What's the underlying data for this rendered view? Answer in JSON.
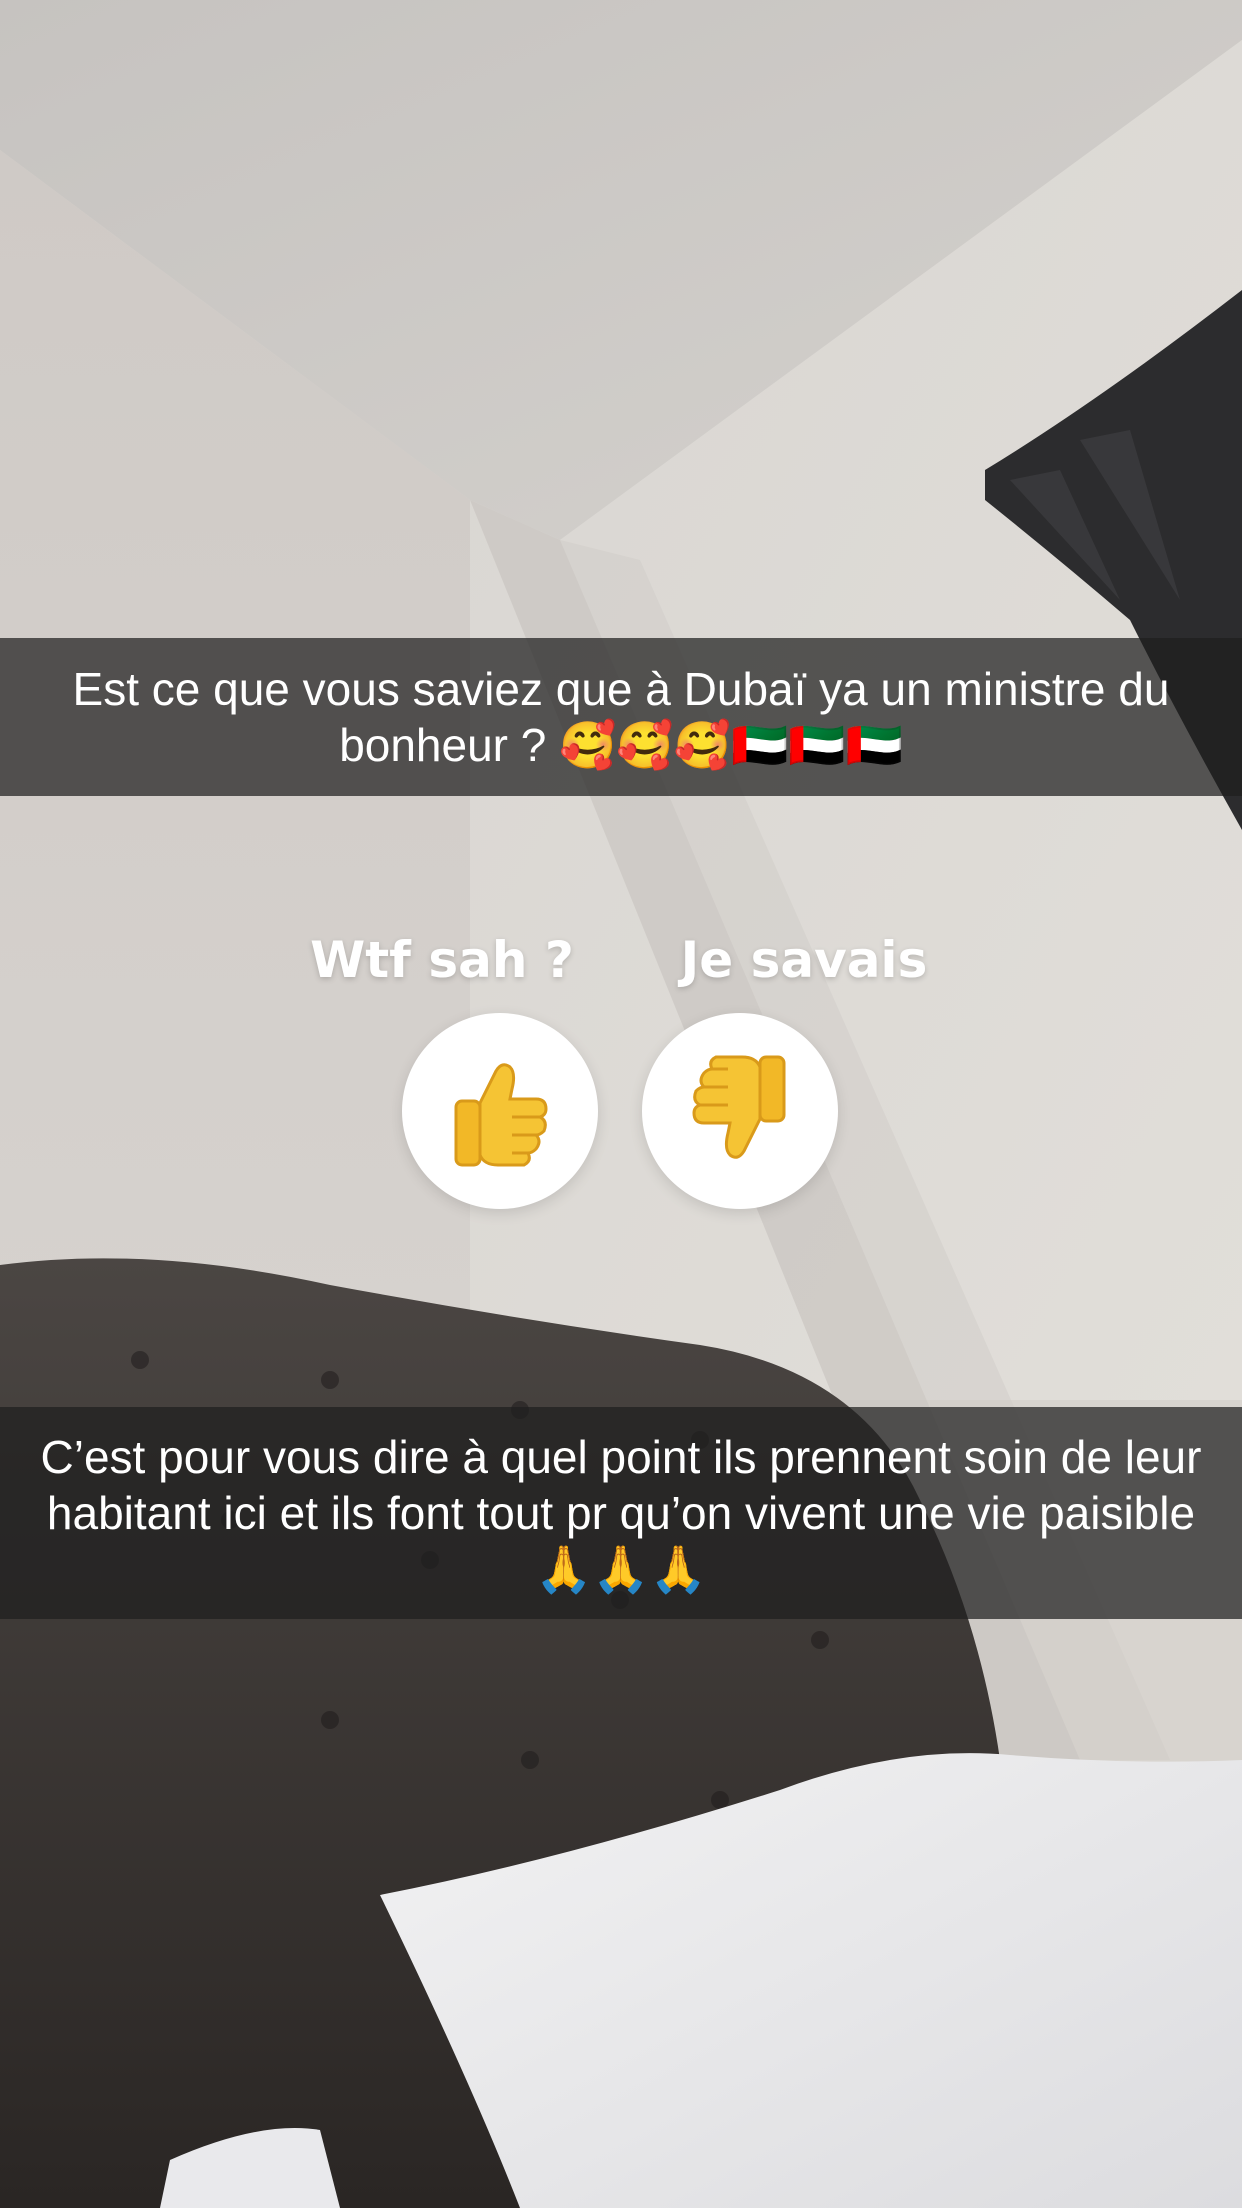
{
  "captions": {
    "top": "Est ce que vous saviez que à Dubaï ya un ministre du bonheur ? 🥰🥰🥰🇦🇪🇦🇪🇦🇪",
    "bottom": "C’est pour vous dire à quel point ils prennent soin de leur habitant ici et ils font tout pr qu’on vivent une vie paisible 🙏🙏🙏"
  },
  "poll": {
    "options": [
      {
        "label": "Wtf sah ?",
        "icon": "thumbs-up-icon"
      },
      {
        "label": "Je savais",
        "icon": "thumbs-down-icon"
      }
    ]
  },
  "colors": {
    "caption_bar": "rgba(30,30,30,0.72)",
    "caption_text": "#ffffff",
    "poll_button": "#ffffff",
    "thumb_emoji": "#f5c434"
  }
}
